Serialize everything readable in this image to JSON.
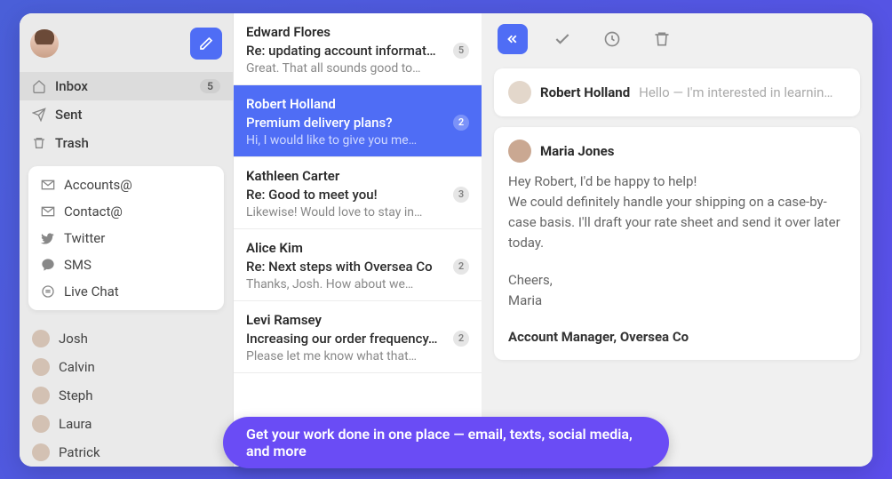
{
  "sidebar": {
    "compose_label": "Compose",
    "folders": [
      {
        "id": "inbox",
        "label": "Inbox",
        "count": "5",
        "active": true
      },
      {
        "id": "sent",
        "label": "Sent"
      },
      {
        "id": "trash",
        "label": "Trash"
      }
    ],
    "channels": [
      {
        "id": "accounts",
        "label": "Accounts@"
      },
      {
        "id": "contact",
        "label": "Contact@"
      },
      {
        "id": "twitter",
        "label": "Twitter"
      },
      {
        "id": "sms",
        "label": "SMS"
      },
      {
        "id": "livechat",
        "label": "Live Chat"
      }
    ],
    "team": [
      {
        "name": "Josh"
      },
      {
        "name": "Calvin"
      },
      {
        "name": "Steph"
      },
      {
        "name": "Laura"
      },
      {
        "name": "Patrick"
      }
    ]
  },
  "conversations": [
    {
      "sender": "Edward Flores",
      "subject": "Re: updating account informat…",
      "count": "5",
      "preview": "Great. That all sounds good to…"
    },
    {
      "sender": "Robert Holland",
      "subject": "Premium delivery plans?",
      "count": "2",
      "preview": "Hi, I would like to give you me…",
      "selected": true
    },
    {
      "sender": "Kathleen Carter",
      "subject": "Re: Good to meet you!",
      "count": "3",
      "preview": "Likewise! Would love to stay in…"
    },
    {
      "sender": "Alice Kim",
      "subject": "Re: Next steps with Oversea Co",
      "count": "2",
      "preview": "Thanks, Josh. How about we…"
    },
    {
      "sender": "Levi Ramsey",
      "subject": "Increasing our order frequency…",
      "count": "2",
      "preview": "Please let me know what that…"
    }
  ],
  "reader": {
    "thread_from": "Robert Holland",
    "thread_excerpt": "Hello — I'm interested in learnin…",
    "reply_from": "Maria Jones",
    "body_line1": "Hey Robert, I'd be happy to help!",
    "body_line2": "We could definitely handle your shipping on a case-by-case basis. I'll draft your rate sheet and send it over later today.",
    "body_signoff": "Cheers,",
    "body_name": "Maria",
    "body_title": "Account Manager, Oversea Co"
  },
  "cta": "Get your work done in one place — email, texts, social media, and more"
}
